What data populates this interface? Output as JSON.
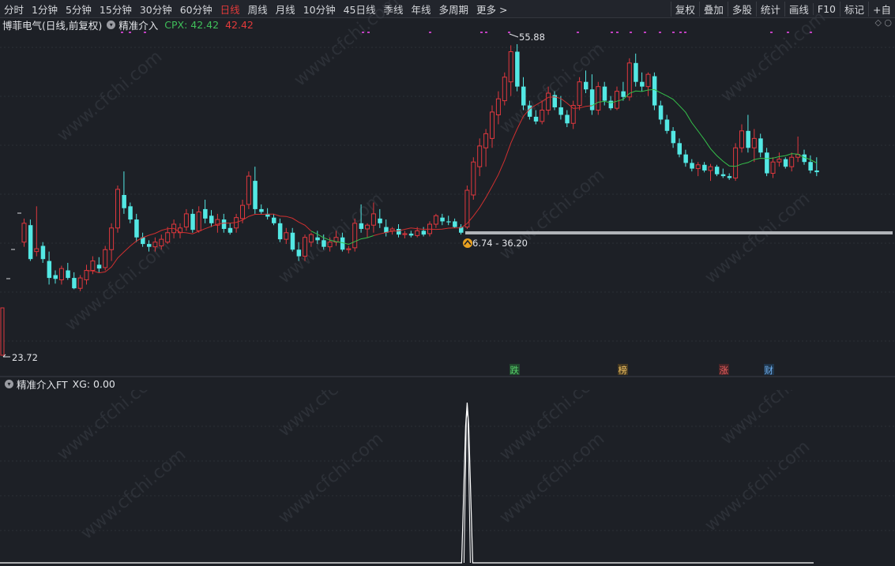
{
  "toolbar": {
    "timeframes": [
      "分时",
      "1分钟",
      "5分钟",
      "15分钟",
      "30分钟",
      "60分钟",
      "日线",
      "周线",
      "月线",
      "10分钟",
      "45日线",
      "季线",
      "年线",
      "多周期",
      "更多 >"
    ],
    "active_timeframe": "日线",
    "tools": [
      "复权",
      "叠加",
      "多股",
      "统计",
      "画线",
      "F10",
      "标记",
      "+自"
    ]
  },
  "main_chart": {
    "stock_name": "博菲电气(日线,前复权)",
    "indicator_name": "精准介入",
    "cpx_label": "CPX:",
    "cpx_value": "42.42",
    "cpx_value2": "42.42",
    "high_label": "55.88",
    "low_label": "23.72",
    "range_label": "6.74 - 36.20",
    "event_tags": [
      "跌",
      "榜",
      "涨",
      "财"
    ]
  },
  "sub_chart": {
    "indicator_name": "精准介入FT",
    "xg_label": "XG: 0.00"
  },
  "watermark": "www.cfchi.com",
  "colors": {
    "background": "#1d2026",
    "up": "#e0383e",
    "down": "#53e8e4",
    "ma_green": "#35c04a",
    "ma_red": "#d03030",
    "active_tab": "#e23a3a",
    "signal_line": "#ffffff",
    "marker": "#c040c0"
  },
  "chart_data": {
    "type": "candlestick",
    "ylim": [
      23,
      57
    ],
    "candles": [
      {
        "o": 35.0,
        "h": 37.5,
        "l": 34.5,
        "c": 37.0
      },
      {
        "o": 36.8,
        "h": 37.4,
        "l": 33.0,
        "c": 33.2
      },
      {
        "o": 34.0,
        "h": 38.8,
        "l": 33.5,
        "c": 34.3
      },
      {
        "o": 34.6,
        "h": 35.0,
        "l": 32.8,
        "c": 33.2
      },
      {
        "o": 33.0,
        "h": 34.0,
        "l": 30.5,
        "c": 31.2
      },
      {
        "o": 31.5,
        "h": 32.0,
        "l": 30.6,
        "c": 31.1
      },
      {
        "o": 31.0,
        "h": 32.5,
        "l": 30.5,
        "c": 32.2
      },
      {
        "o": 32.0,
        "h": 32.8,
        "l": 31.0,
        "c": 31.2
      },
      {
        "o": 31.2,
        "h": 31.8,
        "l": 30.0,
        "c": 30.1
      },
      {
        "o": 30.1,
        "h": 31.5,
        "l": 29.8,
        "c": 31.2
      },
      {
        "o": 31.0,
        "h": 32.6,
        "l": 30.5,
        "c": 32.0
      },
      {
        "o": 32.0,
        "h": 33.5,
        "l": 31.6,
        "c": 33.0
      },
      {
        "o": 32.6,
        "h": 33.4,
        "l": 31.8,
        "c": 32.2
      },
      {
        "o": 32.3,
        "h": 34.6,
        "l": 32.0,
        "c": 34.2
      },
      {
        "o": 34.2,
        "h": 37.0,
        "l": 33.0,
        "c": 36.5
      },
      {
        "o": 36.5,
        "h": 41.0,
        "l": 36.0,
        "c": 40.6
      },
      {
        "o": 40.0,
        "h": 42.5,
        "l": 38.0,
        "c": 38.6
      },
      {
        "o": 38.8,
        "h": 39.2,
        "l": 37.0,
        "c": 37.4
      },
      {
        "o": 37.4,
        "h": 38.0,
        "l": 35.0,
        "c": 35.5
      },
      {
        "o": 35.5,
        "h": 36.0,
        "l": 34.5,
        "c": 34.8
      },
      {
        "o": 34.8,
        "h": 35.2,
        "l": 34.0,
        "c": 34.5
      },
      {
        "o": 34.5,
        "h": 35.5,
        "l": 34.0,
        "c": 35.0
      },
      {
        "o": 34.6,
        "h": 35.8,
        "l": 34.2,
        "c": 35.3
      },
      {
        "o": 35.0,
        "h": 36.6,
        "l": 34.8,
        "c": 36.0
      },
      {
        "o": 36.0,
        "h": 37.4,
        "l": 35.4,
        "c": 36.9
      },
      {
        "o": 36.0,
        "h": 37.0,
        "l": 35.4,
        "c": 36.5
      },
      {
        "o": 36.6,
        "h": 38.5,
        "l": 36.2,
        "c": 38.0
      },
      {
        "o": 38.0,
        "h": 38.5,
        "l": 36.0,
        "c": 36.3
      },
      {
        "o": 36.2,
        "h": 38.8,
        "l": 36.0,
        "c": 38.2
      },
      {
        "o": 38.5,
        "h": 39.5,
        "l": 37.0,
        "c": 37.5
      },
      {
        "o": 37.8,
        "h": 38.4,
        "l": 36.6,
        "c": 37.0
      },
      {
        "o": 36.8,
        "h": 38.0,
        "l": 36.0,
        "c": 37.4
      },
      {
        "o": 37.4,
        "h": 38.0,
        "l": 36.0,
        "c": 36.4
      },
      {
        "o": 36.5,
        "h": 37.0,
        "l": 35.8,
        "c": 36.0
      },
      {
        "o": 36.5,
        "h": 38.0,
        "l": 36.0,
        "c": 37.6
      },
      {
        "o": 37.5,
        "h": 39.5,
        "l": 37.0,
        "c": 38.9
      },
      {
        "o": 39.0,
        "h": 42.5,
        "l": 38.5,
        "c": 42.0
      },
      {
        "o": 41.5,
        "h": 43.0,
        "l": 38.0,
        "c": 38.5
      },
      {
        "o": 38.5,
        "h": 39.0,
        "l": 38.0,
        "c": 38.2
      },
      {
        "o": 38.0,
        "h": 38.6,
        "l": 37.4,
        "c": 37.7
      },
      {
        "o": 37.6,
        "h": 38.0,
        "l": 36.8,
        "c": 37.0
      },
      {
        "o": 37.0,
        "h": 37.5,
        "l": 35.0,
        "c": 35.3
      },
      {
        "o": 35.3,
        "h": 36.5,
        "l": 34.8,
        "c": 36.0
      },
      {
        "o": 36.0,
        "h": 36.5,
        "l": 34.0,
        "c": 34.2
      },
      {
        "o": 34.2,
        "h": 35.0,
        "l": 33.0,
        "c": 33.5
      },
      {
        "o": 33.5,
        "h": 35.8,
        "l": 33.0,
        "c": 35.5
      },
      {
        "o": 35.0,
        "h": 36.0,
        "l": 34.5,
        "c": 35.8
      },
      {
        "o": 35.5,
        "h": 36.2,
        "l": 34.8,
        "c": 35.2
      },
      {
        "o": 35.2,
        "h": 35.8,
        "l": 34.2,
        "c": 34.5
      },
      {
        "o": 34.5,
        "h": 35.5,
        "l": 34.0,
        "c": 35.0
      },
      {
        "o": 35.0,
        "h": 36.2,
        "l": 34.6,
        "c": 35.5
      },
      {
        "o": 35.5,
        "h": 36.0,
        "l": 34.0,
        "c": 34.2
      },
      {
        "o": 34.2,
        "h": 34.6,
        "l": 33.8,
        "c": 34.3
      },
      {
        "o": 34.4,
        "h": 37.5,
        "l": 34.0,
        "c": 37.0
      },
      {
        "o": 37.0,
        "h": 39.0,
        "l": 36.0,
        "c": 36.4
      },
      {
        "o": 36.4,
        "h": 37.0,
        "l": 35.5,
        "c": 36.8
      },
      {
        "o": 36.8,
        "h": 39.2,
        "l": 36.0,
        "c": 38.0
      },
      {
        "o": 37.5,
        "h": 38.5,
        "l": 36.5,
        "c": 37.0
      },
      {
        "o": 36.6,
        "h": 37.4,
        "l": 35.6,
        "c": 36.0
      },
      {
        "o": 36.2,
        "h": 36.6,
        "l": 35.8,
        "c": 36.4
      },
      {
        "o": 36.4,
        "h": 36.9,
        "l": 35.5,
        "c": 35.8
      },
      {
        "o": 35.8,
        "h": 36.2,
        "l": 35.4,
        "c": 35.9
      },
      {
        "o": 35.9,
        "h": 36.2,
        "l": 35.5,
        "c": 35.7
      },
      {
        "o": 35.7,
        "h": 36.6,
        "l": 35.5,
        "c": 36.2
      },
      {
        "o": 36.2,
        "h": 36.6,
        "l": 35.6,
        "c": 35.8
      },
      {
        "o": 35.9,
        "h": 37.2,
        "l": 35.6,
        "c": 36.9
      },
      {
        "o": 36.9,
        "h": 38.0,
        "l": 36.5,
        "c": 37.8
      },
      {
        "o": 37.6,
        "h": 38.0,
        "l": 36.8,
        "c": 37.2
      },
      {
        "o": 37.2,
        "h": 37.8,
        "l": 36.8,
        "c": 37.1
      },
      {
        "o": 37.2,
        "h": 37.5,
        "l": 36.5,
        "c": 36.6
      },
      {
        "o": 36.6,
        "h": 36.9,
        "l": 35.8,
        "c": 36.0
      },
      {
        "o": 36.6,
        "h": 41.0,
        "l": 36.4,
        "c": 40.5
      },
      {
        "o": 40.0,
        "h": 44.0,
        "l": 39.5,
        "c": 43.5
      },
      {
        "o": 43.0,
        "h": 46.0,
        "l": 42.0,
        "c": 45.2
      },
      {
        "o": 45.0,
        "h": 47.0,
        "l": 43.0,
        "c": 46.5
      },
      {
        "o": 46.0,
        "h": 49.5,
        "l": 45.0,
        "c": 48.8
      },
      {
        "o": 48.5,
        "h": 51.0,
        "l": 47.5,
        "c": 50.2
      },
      {
        "o": 50.0,
        "h": 53.0,
        "l": 49.5,
        "c": 52.5
      },
      {
        "o": 52.0,
        "h": 55.88,
        "l": 50.5,
        "c": 55.2
      },
      {
        "o": 55.2,
        "h": 56.0,
        "l": 51.0,
        "c": 51.5
      },
      {
        "o": 51.5,
        "h": 52.5,
        "l": 49.0,
        "c": 49.5
      },
      {
        "o": 49.5,
        "h": 50.0,
        "l": 48.0,
        "c": 48.3
      },
      {
        "o": 48.3,
        "h": 49.0,
        "l": 47.5,
        "c": 47.8
      },
      {
        "o": 47.8,
        "h": 50.0,
        "l": 47.5,
        "c": 49.0
      },
      {
        "o": 49.0,
        "h": 51.5,
        "l": 48.5,
        "c": 50.8
      },
      {
        "o": 50.6,
        "h": 51.0,
        "l": 49.0,
        "c": 49.3
      },
      {
        "o": 49.3,
        "h": 50.5,
        "l": 48.0,
        "c": 48.5
      },
      {
        "o": 48.5,
        "h": 49.0,
        "l": 47.2,
        "c": 47.6
      },
      {
        "o": 47.6,
        "h": 50.0,
        "l": 47.0,
        "c": 49.5
      },
      {
        "o": 49.5,
        "h": 52.5,
        "l": 49.0,
        "c": 52.0
      },
      {
        "o": 52.0,
        "h": 53.2,
        "l": 50.8,
        "c": 51.2
      },
      {
        "o": 51.2,
        "h": 52.8,
        "l": 48.5,
        "c": 49.0
      },
      {
        "o": 49.0,
        "h": 52.0,
        "l": 48.5,
        "c": 51.5
      },
      {
        "o": 51.5,
        "h": 52.0,
        "l": 49.5,
        "c": 50.0
      },
      {
        "o": 50.0,
        "h": 50.5,
        "l": 49.0,
        "c": 49.2
      },
      {
        "o": 49.2,
        "h": 51.5,
        "l": 49.0,
        "c": 51.0
      },
      {
        "o": 51.0,
        "h": 52.0,
        "l": 50.0,
        "c": 50.4
      },
      {
        "o": 50.4,
        "h": 54.5,
        "l": 50.0,
        "c": 54.0
      },
      {
        "o": 54.0,
        "h": 55.0,
        "l": 51.5,
        "c": 52.0
      },
      {
        "o": 52.0,
        "h": 53.0,
        "l": 51.0,
        "c": 51.5
      },
      {
        "o": 51.5,
        "h": 53.0,
        "l": 50.5,
        "c": 52.8
      },
      {
        "o": 52.6,
        "h": 53.0,
        "l": 49.0,
        "c": 49.5
      },
      {
        "o": 49.5,
        "h": 50.0,
        "l": 47.5,
        "c": 48.0
      },
      {
        "o": 48.0,
        "h": 48.5,
        "l": 46.5,
        "c": 46.8
      },
      {
        "o": 46.8,
        "h": 47.2,
        "l": 45.0,
        "c": 45.5
      },
      {
        "o": 45.5,
        "h": 46.0,
        "l": 44.0,
        "c": 44.3
      },
      {
        "o": 44.3,
        "h": 44.8,
        "l": 43.0,
        "c": 43.4
      },
      {
        "o": 43.4,
        "h": 43.8,
        "l": 42.5,
        "c": 42.8
      },
      {
        "o": 42.8,
        "h": 43.5,
        "l": 42.0,
        "c": 43.2
      },
      {
        "o": 43.2,
        "h": 43.5,
        "l": 42.4,
        "c": 42.6
      },
      {
        "o": 42.6,
        "h": 43.3,
        "l": 41.5,
        "c": 43.0
      },
      {
        "o": 43.0,
        "h": 43.2,
        "l": 42.0,
        "c": 42.2
      },
      {
        "o": 42.2,
        "h": 42.8,
        "l": 41.8,
        "c": 42.0
      },
      {
        "o": 42.0,
        "h": 42.3,
        "l": 41.6,
        "c": 41.8
      },
      {
        "o": 41.8,
        "h": 45.5,
        "l": 41.5,
        "c": 45.0
      },
      {
        "o": 45.0,
        "h": 47.5,
        "l": 44.5,
        "c": 46.8
      },
      {
        "o": 46.8,
        "h": 48.5,
        "l": 44.5,
        "c": 45.0
      },
      {
        "o": 45.0,
        "h": 47.0,
        "l": 43.5,
        "c": 46.0
      },
      {
        "o": 46.0,
        "h": 46.5,
        "l": 44.0,
        "c": 44.5
      },
      {
        "o": 44.5,
        "h": 45.0,
        "l": 42.0,
        "c": 42.3
      },
      {
        "o": 42.3,
        "h": 44.0,
        "l": 41.8,
        "c": 43.5
      },
      {
        "o": 43.5,
        "h": 44.5,
        "l": 43.0,
        "c": 43.8
      },
      {
        "o": 43.8,
        "h": 44.0,
        "l": 42.8,
        "c": 43.0
      },
      {
        "o": 43.0,
        "h": 44.5,
        "l": 42.5,
        "c": 44.0
      },
      {
        "o": 44.0,
        "h": 46.2,
        "l": 43.5,
        "c": 44.3
      },
      {
        "o": 44.3,
        "h": 44.8,
        "l": 43.2,
        "c": 43.5
      },
      {
        "o": 43.5,
        "h": 44.2,
        "l": 42.3,
        "c": 42.6
      },
      {
        "o": 42.6,
        "h": 44.0,
        "l": 42.0,
        "c": 42.42
      }
    ],
    "ma_start_index": 10,
    "ma_red_to_green_index": 46,
    "ma_green_end_index": 56,
    "ma_second_red_start_index": 56,
    "ma_second_red_end_index": 91,
    "ma_second_green_end_index": 129,
    "signal_bar_index": 71,
    "signal_xg_peak": 1.0
  }
}
